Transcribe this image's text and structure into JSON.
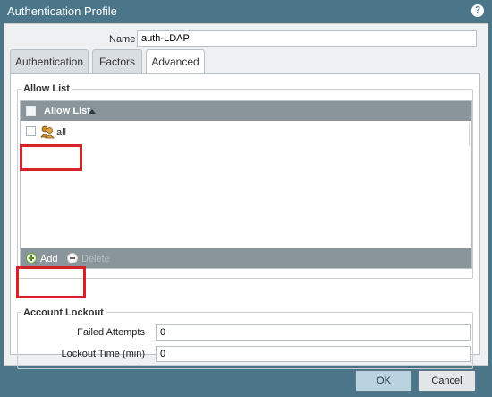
{
  "dialog": {
    "title": "Authentication Profile",
    "help_glyph": "?"
  },
  "name_field": {
    "label": "Name",
    "value": "auth-LDAP"
  },
  "tabs": [
    {
      "label": "Authentication",
      "active": false
    },
    {
      "label": "Factors",
      "active": false
    },
    {
      "label": "Advanced",
      "active": true
    }
  ],
  "allow_list": {
    "legend": "Allow List",
    "column_header": "Allow List",
    "sort_icon": "sort-ascending-icon",
    "rows": [
      {
        "label": "all",
        "icon": "user-group-icon"
      }
    ],
    "footer": {
      "add_label": "Add",
      "delete_label": "Delete",
      "add_icon": "plus-circle-icon",
      "delete_icon": "minus-circle-icon"
    }
  },
  "account_lockout": {
    "legend": "Account Lockout",
    "failed_attempts": {
      "label": "Failed Attempts",
      "value": "0"
    },
    "lockout_time": {
      "label": "Lockout Time (min)",
      "value": "0"
    }
  },
  "buttons": {
    "ok": "OK",
    "cancel": "Cancel"
  },
  "colors": {
    "titlebar": "#4b7588",
    "grid_header": "#8a959b",
    "highlight": "#d8202a"
  }
}
